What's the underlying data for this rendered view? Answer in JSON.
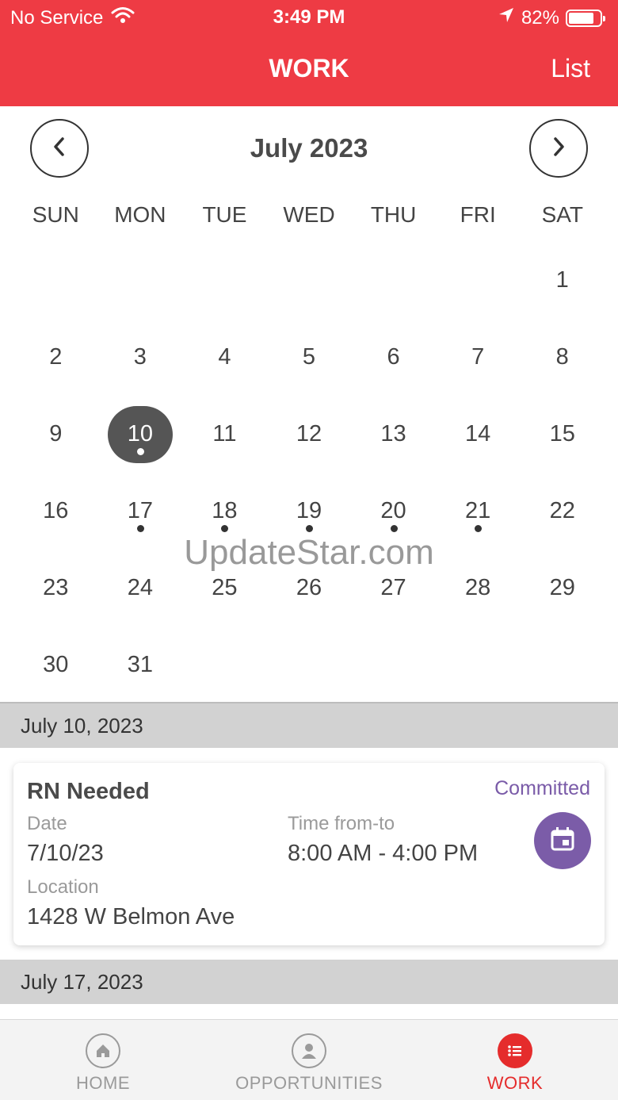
{
  "status_bar": {
    "carrier": "No Service",
    "time": "3:49 PM",
    "battery": "82%",
    "battery_level": 0.82
  },
  "nav": {
    "title": "WORK",
    "right_action": "List"
  },
  "calendar": {
    "month_label": "July 2023",
    "weekdays": [
      "SUN",
      "MON",
      "TUE",
      "WED",
      "THU",
      "FRI",
      "SAT"
    ],
    "days": [
      {
        "n": ""
      },
      {
        "n": ""
      },
      {
        "n": ""
      },
      {
        "n": ""
      },
      {
        "n": ""
      },
      {
        "n": ""
      },
      {
        "n": "1"
      },
      {
        "n": "2"
      },
      {
        "n": "3"
      },
      {
        "n": "4"
      },
      {
        "n": "5"
      },
      {
        "n": "6"
      },
      {
        "n": "7"
      },
      {
        "n": "8"
      },
      {
        "n": "9"
      },
      {
        "n": "10",
        "selected": true,
        "dot": true
      },
      {
        "n": "11"
      },
      {
        "n": "12"
      },
      {
        "n": "13"
      },
      {
        "n": "14"
      },
      {
        "n": "15"
      },
      {
        "n": "16"
      },
      {
        "n": "17",
        "dot": true
      },
      {
        "n": "18",
        "dot": true
      },
      {
        "n": "19",
        "dot": true
      },
      {
        "n": "20",
        "dot": true
      },
      {
        "n": "21",
        "dot": true
      },
      {
        "n": "22"
      },
      {
        "n": "23"
      },
      {
        "n": "24"
      },
      {
        "n": "25"
      },
      {
        "n": "26"
      },
      {
        "n": "27"
      },
      {
        "n": "28"
      },
      {
        "n": "29"
      },
      {
        "n": "30"
      },
      {
        "n": "31"
      }
    ]
  },
  "watermark": "UpdateStar.com",
  "sections": [
    {
      "date_header": "July 10, 2023"
    },
    {
      "date_header": "July 17, 2023"
    }
  ],
  "shift_card": {
    "title": "RN Needed",
    "status": "Committed",
    "date_label": "Date",
    "date_value": "7/10/23",
    "time_label": "Time from-to",
    "time_value": "8:00 AM - 4:00 PM",
    "location_label": "Location",
    "location_value": "1428 W Belmon Ave"
  },
  "tabbar": {
    "tabs": [
      {
        "label": "HOME",
        "icon": "home-icon"
      },
      {
        "label": "OPPORTUNITIES",
        "icon": "person-icon"
      },
      {
        "label": "WORK",
        "icon": "list-icon",
        "active": true
      }
    ]
  },
  "colors": {
    "header_red": "#ee3b44",
    "committed_purple": "#7a5ba8",
    "active_tab_red": "#e52c2c",
    "selected_day": "#555555"
  }
}
